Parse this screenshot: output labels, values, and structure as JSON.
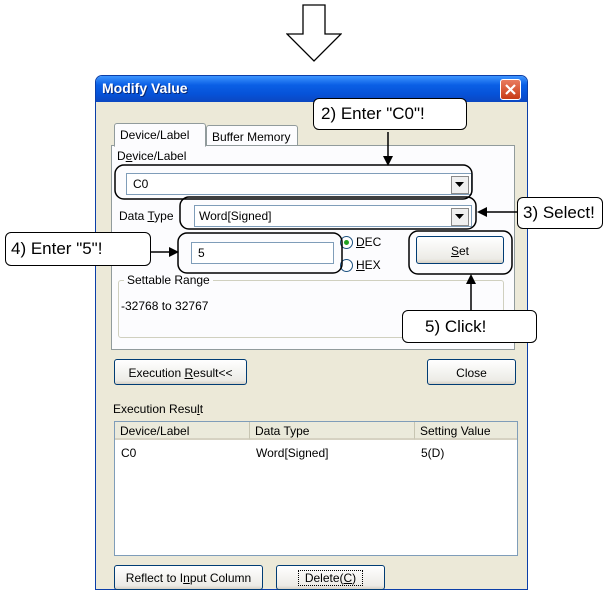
{
  "window": {
    "title": "Modify Value"
  },
  "tabs": [
    {
      "label": "Device/Label",
      "active": true
    },
    {
      "label": "Buffer Memory",
      "active": false
    }
  ],
  "device_label": {
    "label_pre": "D",
    "label_acc": "e",
    "label_post": "vice/Label",
    "value": "C0"
  },
  "data_type": {
    "label_pre": "Data ",
    "label_acc": "T",
    "label_post": "ype",
    "value": "Word[Signed]"
  },
  "value_input": {
    "value": "5"
  },
  "radix": {
    "dec_acc": "D",
    "dec_post": "EC",
    "hex_acc": "H",
    "hex_post": "EX",
    "selected": "DEC"
  },
  "set_button": {
    "acc": "S",
    "post": "et"
  },
  "settable_range": {
    "label": "Settable Range",
    "value": "-32768 to 32767"
  },
  "execution_result_button": {
    "pre": "Execution ",
    "acc": "R",
    "post": "esult<<"
  },
  "close_button": {
    "label": "Close"
  },
  "execution_result": {
    "label_pre": "Execution Resu",
    "label_acc": "l",
    "label_post": "t",
    "columns": [
      "Device/Label",
      "Data Type",
      "Setting Value"
    ],
    "rows": [
      [
        "C0",
        "Word[Signed]",
        "5(D)"
      ]
    ]
  },
  "reflect_button": {
    "pre": "Reflect to I",
    "acc": "n",
    "post": "put Column"
  },
  "delete_button": {
    "pre": "Delete(",
    "acc": "C",
    "post": ")"
  },
  "callouts": {
    "step2": "2) Enter \"C0\"!",
    "step3": "3) Select!",
    "step4": "4) Enter \"5\"!",
    "step5": "5) Click!"
  },
  "colors": {
    "titlebar": "#0a5fe5",
    "dialog_face": "#ece9d8",
    "close_button": "#c83a15"
  }
}
